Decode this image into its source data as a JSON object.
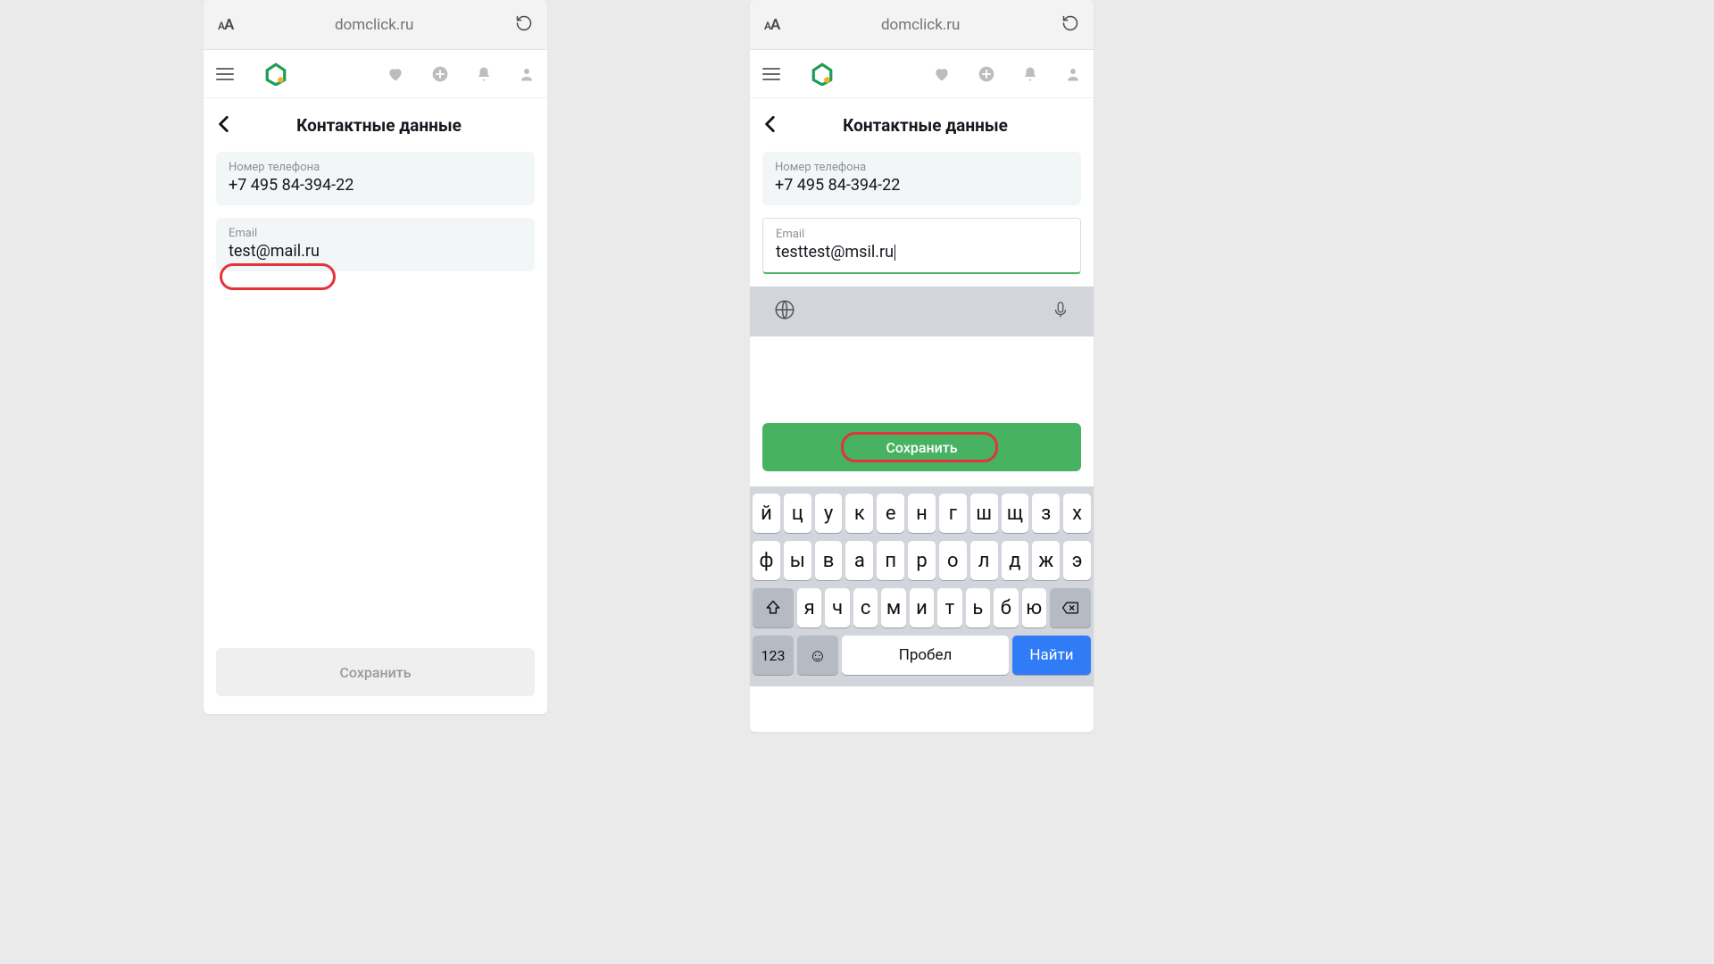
{
  "browser": {
    "url": "domclick.ru",
    "text_size": "AA"
  },
  "page_title": "Контактные данные",
  "phone_field": {
    "label": "Номер телефона",
    "value": "+7 495 84-394-22"
  },
  "left": {
    "email_field": {
      "label": "Email",
      "value": "test@mail.ru"
    },
    "save_label": "Сохранить"
  },
  "right": {
    "email_field": {
      "label": "Email",
      "value": "testtest@msil.ru"
    },
    "save_label": "Сохранить"
  },
  "keyboard": {
    "row1": [
      "й",
      "ц",
      "у",
      "к",
      "е",
      "н",
      "г",
      "ш",
      "щ",
      "з",
      "х"
    ],
    "row2": [
      "ф",
      "ы",
      "в",
      "а",
      "п",
      "р",
      "о",
      "л",
      "д",
      "ж",
      "э"
    ],
    "row3": [
      "я",
      "ч",
      "с",
      "м",
      "и",
      "т",
      "ь",
      "б",
      "ю"
    ],
    "numbers_label": "123",
    "space_label": "Пробел",
    "action_label": "Найти"
  }
}
